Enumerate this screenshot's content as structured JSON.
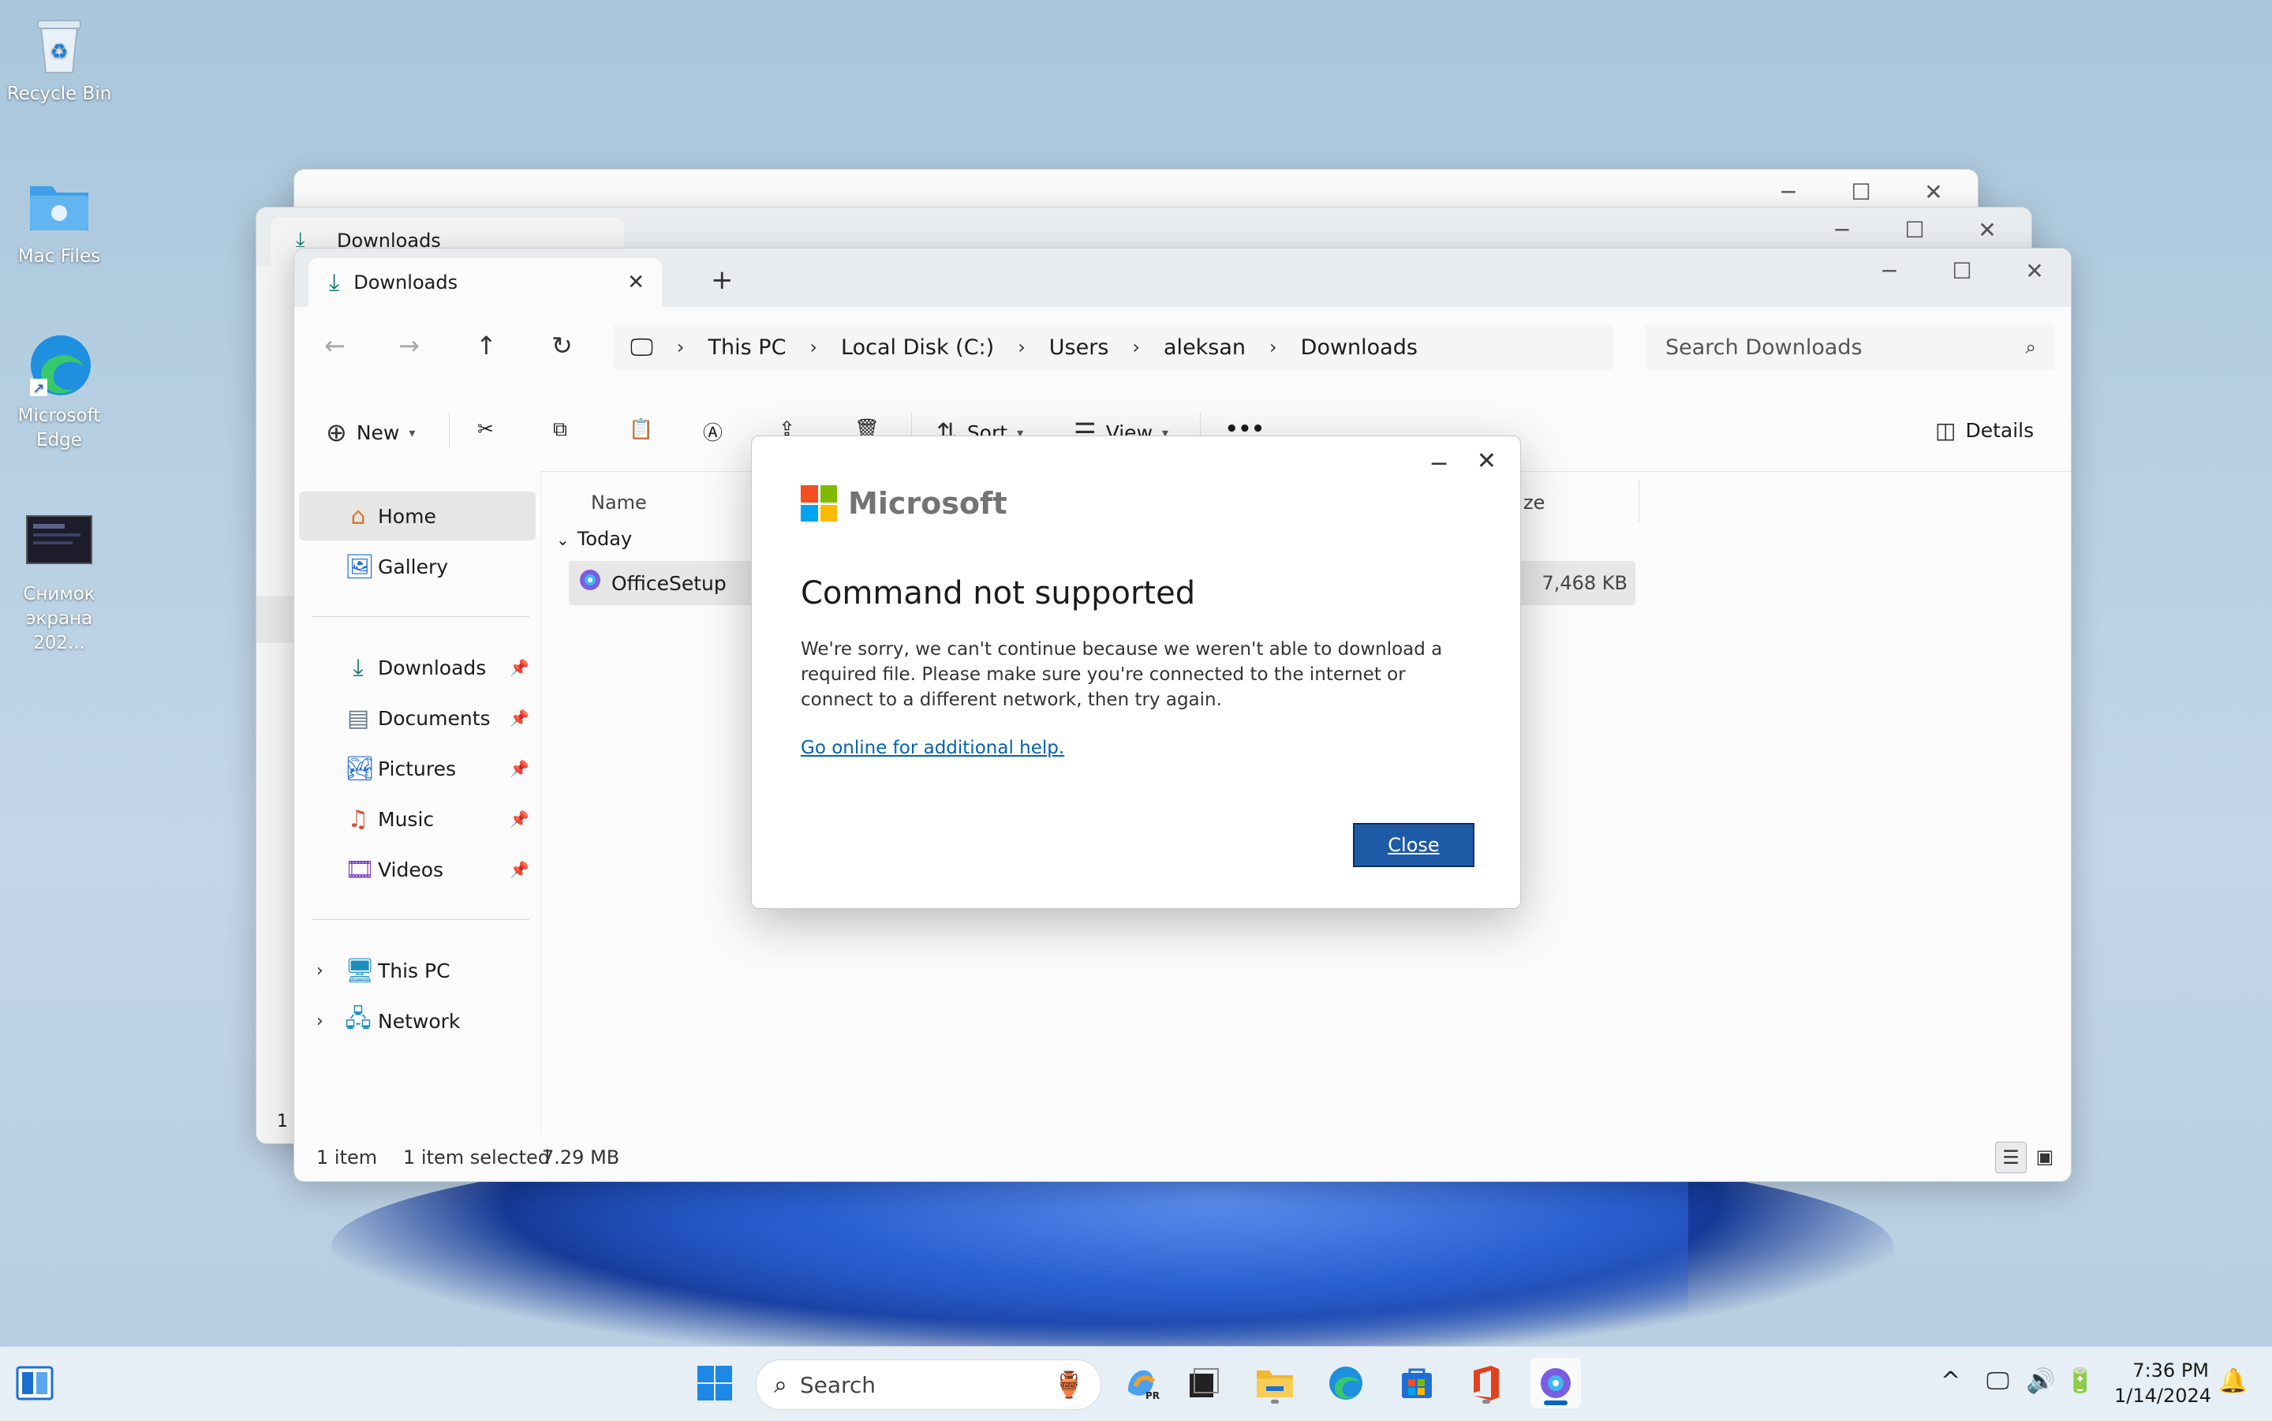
{
  "desktop": {
    "icons": [
      {
        "label": "Recycle Bin"
      },
      {
        "label": "Mac Files"
      },
      {
        "label": "Microsoft Edge"
      },
      {
        "label": "Снимок экрана 202..."
      }
    ]
  },
  "back_window": {
    "tab_label": "Downloads",
    "status_fragment": "1"
  },
  "explorer": {
    "tab": {
      "label": "Downloads"
    },
    "breadcrumb": [
      "This PC",
      "Local Disk (C:)",
      "Users",
      "aleksan",
      "Downloads"
    ],
    "search": {
      "placeholder": "Search Downloads"
    },
    "toolbar": {
      "new_label": "New",
      "sort_label": "Sort",
      "view_label": "View",
      "more_label": "•••",
      "details_label": "Details"
    },
    "sidebar": {
      "top": [
        {
          "label": "Home",
          "icon": "home-icon"
        },
        {
          "label": "Gallery",
          "icon": "gallery-icon"
        }
      ],
      "pinned": [
        {
          "label": "Downloads",
          "icon": "download-icon"
        },
        {
          "label": "Documents",
          "icon": "documents-icon"
        },
        {
          "label": "Pictures",
          "icon": "pictures-icon"
        },
        {
          "label": "Music",
          "icon": "music-icon"
        },
        {
          "label": "Videos",
          "icon": "videos-icon"
        }
      ],
      "tree": [
        {
          "label": "This PC",
          "icon": "computer-icon"
        },
        {
          "label": "Network",
          "icon": "network-icon"
        }
      ]
    },
    "columns": {
      "name": "Name",
      "size_fragment": "ze"
    },
    "group": {
      "label": "Today"
    },
    "files": [
      {
        "name": "OfficeSetup",
        "size": "7,468 KB"
      }
    ],
    "status": {
      "count": "1 item",
      "selected": "1 item selected",
      "size": "7.29 MB"
    }
  },
  "dialog": {
    "brand": "Microsoft",
    "title": "Command not supported",
    "body": "We're sorry, we can't continue because we weren't able to download a required file.  Please make sure you're connected to the internet or connect to a different network, then try again.",
    "link": "Go online for additional help.",
    "close_label": "Close",
    "logo_colors": [
      "#f25022",
      "#7fba00",
      "#00a4ef",
      "#ffb900"
    ]
  },
  "taskbar": {
    "search_placeholder": "Search",
    "time": "7:36 PM",
    "date": "1/14/2024"
  },
  "colors": {
    "accent": "#0067c0",
    "dialog_button": "#1e5aa6",
    "link": "#0063b1"
  }
}
